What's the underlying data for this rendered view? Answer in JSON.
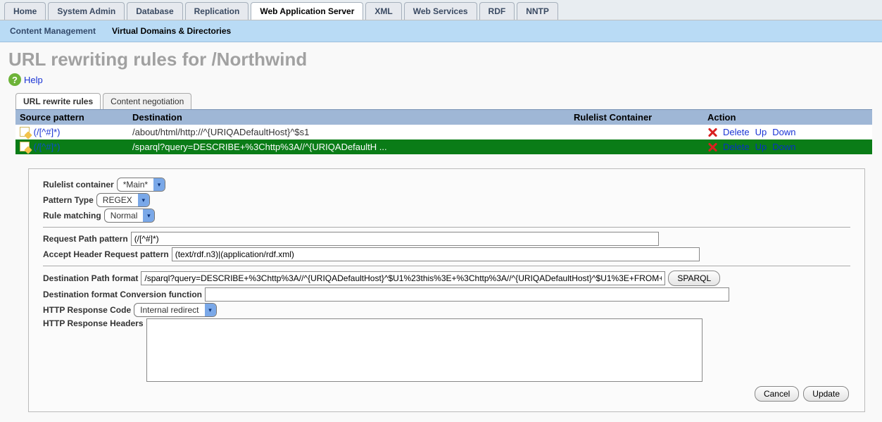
{
  "top_tabs": [
    "Home",
    "System Admin",
    "Database",
    "Replication",
    "Web Application Server",
    "XML",
    "Web Services",
    "RDF",
    "NNTP"
  ],
  "top_tabs_active_index": 4,
  "sub_tabs": [
    "Content Management",
    "Virtual Domains & Directories"
  ],
  "sub_tabs_active_index": 1,
  "page_title": "URL rewriting rules for /Northwind",
  "help_label": "Help",
  "inner_tabs": [
    "URL rewrite rules",
    "Content negotiation"
  ],
  "inner_tabs_active_index": 0,
  "table": {
    "headers": [
      "Source pattern",
      "Destination",
      "Rulelist Container",
      "Action"
    ],
    "rows": [
      {
        "source": "(/[^#]*)",
        "destination": "/about/html/http://^{URIQADefaultHost}^$s1",
        "container": "",
        "selected": false
      },
      {
        "source": "(/[^#]*)",
        "destination": "/sparql?query=DESCRIBE+%3Chttp%3A//^{URIQADefaultH ...",
        "container": "",
        "selected": true
      }
    ],
    "action_labels": {
      "delete": "Delete",
      "up": "Up",
      "down": "Down"
    }
  },
  "form": {
    "rulelist_container_label": "Rulelist container",
    "rulelist_container_value": "*Main*",
    "pattern_type_label": "Pattern Type",
    "pattern_type_value": "REGEX",
    "rule_matching_label": "Rule matching",
    "rule_matching_value": "Normal",
    "request_path_pattern_label": "Request Path pattern",
    "request_path_pattern_value": "(/[^#]*)",
    "accept_header_pattern_label": "Accept Header Request pattern",
    "accept_header_pattern_value": "(text/rdf.n3)|(application/rdf.xml)",
    "destination_path_format_label": "Destination Path format",
    "destination_path_format_value": "/sparql?query=DESCRIBE+%3Chttp%3A//^{URIQADefaultHost}^$U1%23this%3E+%3Chttp%3A//^{URIQADefaultHost}^$U1%3E+FROM+%3Chttp",
    "sparql_btn_label": "SPARQL",
    "dest_conversion_label": "Destination format Conversion function",
    "dest_conversion_value": "",
    "http_response_code_label": "HTTP Response Code",
    "http_response_code_value": "Internal redirect",
    "http_response_headers_label": "HTTP Response Headers",
    "http_response_headers_value": "",
    "cancel_label": "Cancel",
    "update_label": "Update"
  }
}
